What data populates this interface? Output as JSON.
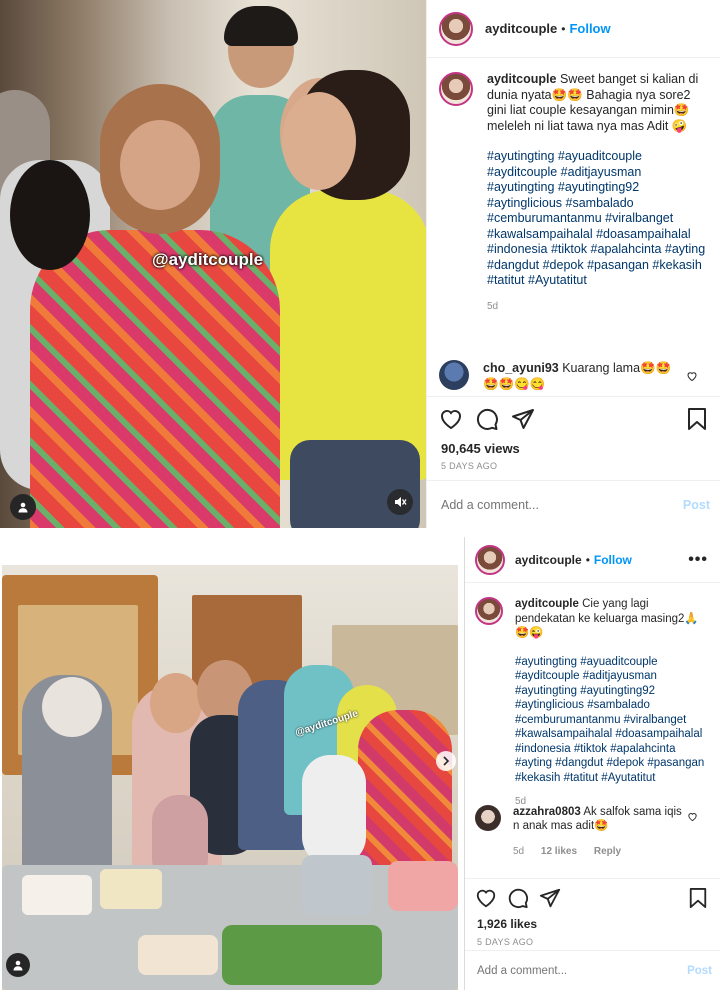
{
  "post1": {
    "username": "ayditcouple",
    "follow_label": "Follow",
    "caption_text": "Sweet banget si kalian di dunia nyata🤩🤩 Bahagia nya sore2 gini liat couple kesayangan mimin🤩 meleleh ni liat tawa nya mas Adit 🤪",
    "hashtags": "#ayutingting #ayuaditcouple #ayditcouple #aditjayusman #ayutingting #ayutingting92 #aytinglicious #sambalado #cemburumantanmu #viralbanget #kawalsampaihalal #doasampaihalal #indonesia #tiktok #apalahcinta #ayting #dangdut #depok #pasangan #kekasih #tatitut #Ayutatitut",
    "caption_age": "5d",
    "comment": {
      "username": "cho_ayuni93",
      "text": "Kuarang lama🤩🤩 🤩🤩😋😋"
    },
    "views": "90,645 views",
    "timestamp": "5 DAYS AGO",
    "add_comment_placeholder": "Add a comment...",
    "post_label": "Post",
    "watermark": "@ayditcouple"
  },
  "post2": {
    "username": "ayditcouple",
    "follow_label": "Follow",
    "caption_text": "Cie yang lagi pendekatan ke keluarga masing2🙏🤩😜",
    "hashtags": "#ayutingting #ayuaditcouple #ayditcouple #aditjayusman #ayutingting #ayutingting92 #aytinglicious #sambalado #cemburumantanmu #viralbanget #kawalsampaihalal #doasampaihalal #indonesia #tiktok #apalahcinta #ayting #dangdut #depok #pasangan #kekasih #tatitut #Ayutatitut",
    "caption_age": "5d",
    "comment": {
      "username": "azzahra0803",
      "text": "Ak salfok sama iqis n anak mas adit🤩",
      "age": "5d",
      "likes": "12 likes",
      "reply": "Reply"
    },
    "likes": "1,926 likes",
    "timestamp": "5 DAYS AGO",
    "add_comment_placeholder": "Add a comment...",
    "post_label": "Post",
    "watermark": "@ayditcouple"
  },
  "colors": {
    "follow_blue": "#0095f6",
    "hashtag_blue": "#00376b",
    "muted_gray": "#8e8e8e",
    "post_disabled": "#b3dbff"
  },
  "icons": [
    "more-icon",
    "heart-icon",
    "comment-icon",
    "share-icon",
    "bookmark-icon",
    "user-tag-icon",
    "mute-icon",
    "chevron-right-icon"
  ]
}
